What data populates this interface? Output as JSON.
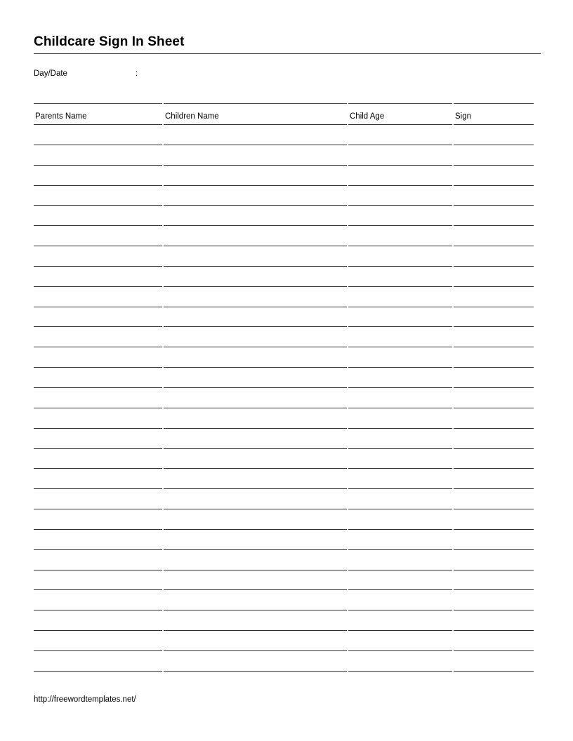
{
  "document": {
    "title": "Childcare Sign In Sheet",
    "daydate": {
      "label": "Day/Date",
      "separator": ":",
      "value": ""
    },
    "footer_url": "http://freewordtemplates.net/"
  },
  "table": {
    "columns": [
      {
        "key": "parents_name",
        "header": "Parents Name"
      },
      {
        "key": "children_name",
        "header": "Children Name"
      },
      {
        "key": "child_age",
        "header": "Child Age"
      },
      {
        "key": "sign",
        "header": "Sign"
      }
    ],
    "row_count": 27,
    "rows": [
      {
        "parents_name": "",
        "children_name": "",
        "child_age": "",
        "sign": ""
      },
      {
        "parents_name": "",
        "children_name": "",
        "child_age": "",
        "sign": ""
      },
      {
        "parents_name": "",
        "children_name": "",
        "child_age": "",
        "sign": ""
      },
      {
        "parents_name": "",
        "children_name": "",
        "child_age": "",
        "sign": ""
      },
      {
        "parents_name": "",
        "children_name": "",
        "child_age": "",
        "sign": ""
      },
      {
        "parents_name": "",
        "children_name": "",
        "child_age": "",
        "sign": ""
      },
      {
        "parents_name": "",
        "children_name": "",
        "child_age": "",
        "sign": ""
      },
      {
        "parents_name": "",
        "children_name": "",
        "child_age": "",
        "sign": ""
      },
      {
        "parents_name": "",
        "children_name": "",
        "child_age": "",
        "sign": ""
      },
      {
        "parents_name": "",
        "children_name": "",
        "child_age": "",
        "sign": ""
      },
      {
        "parents_name": "",
        "children_name": "",
        "child_age": "",
        "sign": ""
      },
      {
        "parents_name": "",
        "children_name": "",
        "child_age": "",
        "sign": ""
      },
      {
        "parents_name": "",
        "children_name": "",
        "child_age": "",
        "sign": ""
      },
      {
        "parents_name": "",
        "children_name": "",
        "child_age": "",
        "sign": ""
      },
      {
        "parents_name": "",
        "children_name": "",
        "child_age": "",
        "sign": ""
      },
      {
        "parents_name": "",
        "children_name": "",
        "child_age": "",
        "sign": ""
      },
      {
        "parents_name": "",
        "children_name": "",
        "child_age": "",
        "sign": ""
      },
      {
        "parents_name": "",
        "children_name": "",
        "child_age": "",
        "sign": ""
      },
      {
        "parents_name": "",
        "children_name": "",
        "child_age": "",
        "sign": ""
      },
      {
        "parents_name": "",
        "children_name": "",
        "child_age": "",
        "sign": ""
      },
      {
        "parents_name": "",
        "children_name": "",
        "child_age": "",
        "sign": ""
      },
      {
        "parents_name": "",
        "children_name": "",
        "child_age": "",
        "sign": ""
      },
      {
        "parents_name": "",
        "children_name": "",
        "child_age": "",
        "sign": ""
      },
      {
        "parents_name": "",
        "children_name": "",
        "child_age": "",
        "sign": ""
      },
      {
        "parents_name": "",
        "children_name": "",
        "child_age": "",
        "sign": ""
      },
      {
        "parents_name": "",
        "children_name": "",
        "child_age": "",
        "sign": ""
      },
      {
        "parents_name": "",
        "children_name": "",
        "child_age": "",
        "sign": ""
      }
    ]
  },
  "colors": {
    "page_background": "#ffffff",
    "text": "#000000",
    "rule": "#2e2e2e",
    "title_rule": "#3a3a3a"
  }
}
